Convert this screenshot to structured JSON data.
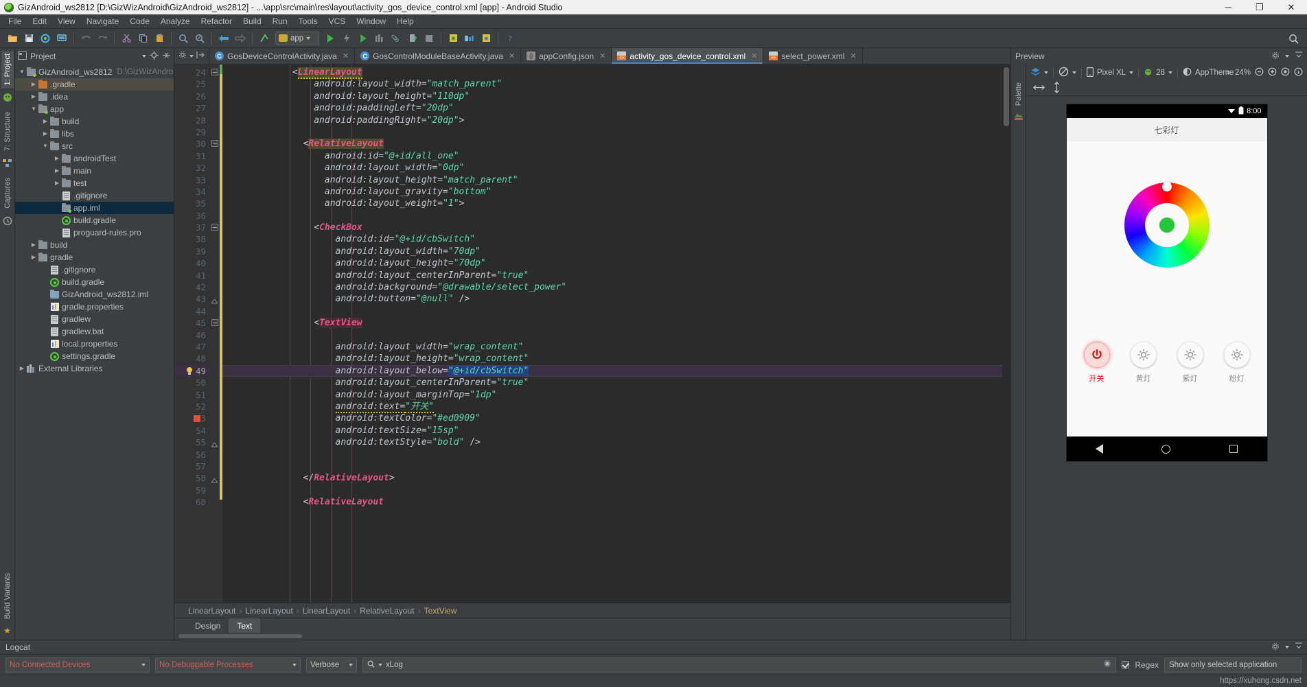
{
  "window": {
    "title": "GizAndroid_ws2812 [D:\\GizWizAndroid\\GizAndroid_ws2812] - ...\\app\\src\\main\\res\\layout\\activity_gos_device_control.xml [app] - Android Studio",
    "minimize": "─",
    "maximize": "❐",
    "close": "✕"
  },
  "menu": [
    "File",
    "Edit",
    "View",
    "Navigate",
    "Code",
    "Analyze",
    "Refactor",
    "Build",
    "Run",
    "Tools",
    "VCS",
    "Window",
    "Help"
  ],
  "toolbar": {
    "run_config": "app",
    "icons": [
      "open-folder-icon",
      "save-all-icon",
      "sync-gradle-icon",
      "avd-manager-icon",
      "undo-icon",
      "redo-icon",
      "cut-icon",
      "copy-icon",
      "paste-icon",
      "find-icon",
      "replace-icon",
      "back-icon",
      "forward-icon",
      "sdk-manager-icon",
      "run-icon",
      "debug-icon",
      "run-coverage-icon",
      "profile-icon",
      "stop-icon",
      "attach-debugger-icon",
      "layout-inspector-icon",
      "device-file-explorer-icon",
      "help-icon"
    ],
    "search_everywhere": "search-icon"
  },
  "left_rail": {
    "tabs": [
      "1: Project",
      "7: Structure",
      "Captures"
    ],
    "bottom_tabs": [
      "Build Variants",
      "Favorites"
    ],
    "active": "1: Project"
  },
  "project_panel": {
    "title": "Project",
    "tree": [
      {
        "indent": 0,
        "arrow": "▼",
        "icon": "module-folder-icon",
        "label": "GizAndroid_ws2812",
        "path": "D:\\GizWizAndroid\\",
        "state": "normal"
      },
      {
        "indent": 1,
        "arrow": "▶",
        "icon": "folder-orange-icon",
        "label": ".gradle",
        "path": "",
        "state": "highlight"
      },
      {
        "indent": 1,
        "arrow": "▶",
        "icon": "folder-icon",
        "label": ".idea",
        "path": "",
        "state": "normal"
      },
      {
        "indent": 1,
        "arrow": "▼",
        "icon": "module-folder-icon",
        "label": "app",
        "path": "",
        "state": "normal"
      },
      {
        "indent": 2,
        "arrow": "▶",
        "icon": "folder-icon",
        "label": "build",
        "path": "",
        "state": "normal"
      },
      {
        "indent": 2,
        "arrow": "▶",
        "icon": "folder-icon",
        "label": "libs",
        "path": "",
        "state": "normal"
      },
      {
        "indent": 2,
        "arrow": "▼",
        "icon": "folder-icon",
        "label": "src",
        "path": "",
        "state": "normal"
      },
      {
        "indent": 3,
        "arrow": "▶",
        "icon": "folder-icon",
        "label": "androidTest",
        "path": "",
        "state": "normal"
      },
      {
        "indent": 3,
        "arrow": "▶",
        "icon": "folder-icon",
        "label": "main",
        "path": "",
        "state": "normal"
      },
      {
        "indent": 3,
        "arrow": "▶",
        "icon": "folder-icon",
        "label": "test",
        "path": "",
        "state": "normal"
      },
      {
        "indent": 3,
        "arrow": "",
        "icon": "file-icon",
        "label": ".gitignore",
        "path": "",
        "state": "normal"
      },
      {
        "indent": 3,
        "arrow": "",
        "icon": "module-folder-icon",
        "label": "app.iml",
        "path": "",
        "state": "selected"
      },
      {
        "indent": 3,
        "arrow": "",
        "icon": "gradle-icon",
        "label": "build.gradle",
        "path": "",
        "state": "normal"
      },
      {
        "indent": 3,
        "arrow": "",
        "icon": "file-icon",
        "label": "proguard-rules.pro",
        "path": "",
        "state": "normal"
      },
      {
        "indent": 1,
        "arrow": "▶",
        "icon": "folder-icon",
        "label": "build",
        "path": "",
        "state": "normal"
      },
      {
        "indent": 1,
        "arrow": "▶",
        "icon": "folder-icon",
        "label": "gradle",
        "path": "",
        "state": "normal"
      },
      {
        "indent": 2,
        "arrow": "",
        "icon": "file-icon",
        "label": ".gitignore",
        "path": "",
        "state": "normal"
      },
      {
        "indent": 2,
        "arrow": "",
        "icon": "gradle-icon",
        "label": "build.gradle",
        "path": "",
        "state": "normal"
      },
      {
        "indent": 2,
        "arrow": "",
        "icon": "iml-icon",
        "label": "GizAndroid_ws2812.iml",
        "path": "",
        "state": "normal"
      },
      {
        "indent": 2,
        "arrow": "",
        "icon": "properties-icon",
        "label": "gradle.properties",
        "path": "",
        "state": "normal"
      },
      {
        "indent": 2,
        "arrow": "",
        "icon": "file-icon",
        "label": "gradlew",
        "path": "",
        "state": "normal"
      },
      {
        "indent": 2,
        "arrow": "",
        "icon": "file-icon",
        "label": "gradlew.bat",
        "path": "",
        "state": "normal"
      },
      {
        "indent": 2,
        "arrow": "",
        "icon": "properties-icon",
        "label": "local.properties",
        "path": "",
        "state": "normal"
      },
      {
        "indent": 2,
        "arrow": "",
        "icon": "gradle-icon",
        "label": "settings.gradle",
        "path": "",
        "state": "normal"
      },
      {
        "indent": 0,
        "arrow": "▶",
        "icon": "library-icon",
        "label": "External Libraries",
        "path": "",
        "state": "normal"
      }
    ]
  },
  "editor": {
    "tabs": [
      {
        "label": "GosDeviceControlActivity.java",
        "icon": "java-class-icon",
        "active": false
      },
      {
        "label": "GosControlModuleBaseActivity.java",
        "icon": "java-class-icon",
        "active": false
      },
      {
        "label": "appConfig.json",
        "icon": "json-file-icon",
        "active": false
      },
      {
        "label": "activity_gos_device_control.xml",
        "icon": "xml-file-icon",
        "active": true
      },
      {
        "label": "select_power.xml",
        "icon": "xml-file-icon",
        "active": false
      }
    ],
    "first_line": 24,
    "current_line": 49,
    "breakpoint_line": 53,
    "bulb_line": 49,
    "lines": [
      {
        "n": 24,
        "segs": [
          {
            "t": "<",
            "c": "pun"
          },
          {
            "t": "LinearLayout",
            "c": "tag hl1 squig"
          }
        ],
        "pad": 6
      },
      {
        "n": 25,
        "segs": [
          {
            "t": "android:layout_width=",
            "c": "attr"
          },
          {
            "t": "\"match_parent\"",
            "c": "val"
          }
        ],
        "pad": 8
      },
      {
        "n": 26,
        "segs": [
          {
            "t": "android:layout_height=",
            "c": "attr"
          },
          {
            "t": "\"110dp\"",
            "c": "val"
          }
        ],
        "pad": 8
      },
      {
        "n": 27,
        "segs": [
          {
            "t": "android:paddingLeft=",
            "c": "attr"
          },
          {
            "t": "\"20dp\"",
            "c": "val"
          }
        ],
        "pad": 8
      },
      {
        "n": 28,
        "segs": [
          {
            "t": "android:paddingRight=",
            "c": "attr"
          },
          {
            "t": "\"20dp\"",
            "c": "val"
          },
          {
            "t": ">",
            "c": "pun"
          }
        ],
        "pad": 8
      },
      {
        "n": 29,
        "segs": [],
        "pad": 0
      },
      {
        "n": 30,
        "segs": [
          {
            "t": "<",
            "c": "pun"
          },
          {
            "t": "RelativeLayout",
            "c": "tag hl1"
          }
        ],
        "pad": 7
      },
      {
        "n": 31,
        "segs": [
          {
            "t": "android:id=",
            "c": "attr"
          },
          {
            "t": "\"@+id/all_one\"",
            "c": "val"
          }
        ],
        "pad": 9
      },
      {
        "n": 32,
        "segs": [
          {
            "t": "android:layout_width=",
            "c": "attr"
          },
          {
            "t": "\"0dp\"",
            "c": "val"
          }
        ],
        "pad": 9
      },
      {
        "n": 33,
        "segs": [
          {
            "t": "android:layout_height=",
            "c": "attr"
          },
          {
            "t": "\"match_parent\"",
            "c": "val"
          }
        ],
        "pad": 9
      },
      {
        "n": 34,
        "segs": [
          {
            "t": "android:layout_gravity=",
            "c": "attr"
          },
          {
            "t": "\"bottom\"",
            "c": "val"
          }
        ],
        "pad": 9
      },
      {
        "n": 35,
        "segs": [
          {
            "t": "android:layout_weight=",
            "c": "attr"
          },
          {
            "t": "\"1\"",
            "c": "val"
          },
          {
            "t": ">",
            "c": "pun"
          }
        ],
        "pad": 9
      },
      {
        "n": 36,
        "segs": [],
        "pad": 0
      },
      {
        "n": 37,
        "segs": [
          {
            "t": "<",
            "c": "pun"
          },
          {
            "t": "CheckBox",
            "c": "tag"
          }
        ],
        "pad": 8
      },
      {
        "n": 38,
        "segs": [
          {
            "t": "android:id=",
            "c": "attr"
          },
          {
            "t": "\"@+id/cbSwitch\"",
            "c": "val"
          }
        ],
        "pad": 10
      },
      {
        "n": 39,
        "segs": [
          {
            "t": "android:layout_width=",
            "c": "attr"
          },
          {
            "t": "\"70dp\"",
            "c": "val"
          }
        ],
        "pad": 10
      },
      {
        "n": 40,
        "segs": [
          {
            "t": "android:layout_height=",
            "c": "attr"
          },
          {
            "t": "\"70dp\"",
            "c": "val"
          }
        ],
        "pad": 10
      },
      {
        "n": 41,
        "segs": [
          {
            "t": "android:layout_centerInParent=",
            "c": "attr"
          },
          {
            "t": "\"true\"",
            "c": "val"
          }
        ],
        "pad": 10
      },
      {
        "n": 42,
        "segs": [
          {
            "t": "android:background=",
            "c": "attr"
          },
          {
            "t": "\"@drawable/select_power\"",
            "c": "val"
          }
        ],
        "pad": 10
      },
      {
        "n": 43,
        "segs": [
          {
            "t": "android:button=",
            "c": "attr"
          },
          {
            "t": "\"@null\"",
            "c": "val"
          },
          {
            "t": " />",
            "c": "pun"
          }
        ],
        "pad": 10
      },
      {
        "n": 44,
        "segs": [],
        "pad": 0
      },
      {
        "n": 45,
        "segs": [
          {
            "t": "<",
            "c": "pun"
          },
          {
            "t": "TextView",
            "c": "tag hl2"
          }
        ],
        "pad": 8
      },
      {
        "n": 46,
        "segs": [],
        "pad": 0
      },
      {
        "n": 47,
        "segs": [
          {
            "t": "android:layout_width=",
            "c": "attr"
          },
          {
            "t": "\"wrap_content\"",
            "c": "val"
          }
        ],
        "pad": 10
      },
      {
        "n": 48,
        "segs": [
          {
            "t": "android:layout_height=",
            "c": "attr"
          },
          {
            "t": "\"wrap_content\"",
            "c": "val"
          }
        ],
        "pad": 10
      },
      {
        "n": 49,
        "segs": [
          {
            "t": "android:layout_below=",
            "c": "attr"
          },
          {
            "t": "\"@+id/cbSwitch\"",
            "c": "val sel"
          }
        ],
        "pad": 10
      },
      {
        "n": 50,
        "segs": [
          {
            "t": "android:layout_centerInParent=",
            "c": "attr"
          },
          {
            "t": "\"true\"",
            "c": "val"
          }
        ],
        "pad": 10
      },
      {
        "n": 51,
        "segs": [
          {
            "t": "android:layout_marginTop=",
            "c": "attr"
          },
          {
            "t": "\"1dp\"",
            "c": "val"
          }
        ],
        "pad": 10
      },
      {
        "n": 52,
        "segs": [
          {
            "t": "android:text=",
            "c": "attr squig"
          },
          {
            "t": "\"开关\"",
            "c": "val squig"
          }
        ],
        "pad": 10
      },
      {
        "n": 53,
        "segs": [
          {
            "t": "android:textColor=",
            "c": "attr"
          },
          {
            "t": "\"#ed0909\"",
            "c": "val"
          }
        ],
        "pad": 10
      },
      {
        "n": 54,
        "segs": [
          {
            "t": "android:textSize=",
            "c": "attr"
          },
          {
            "t": "\"15sp\"",
            "c": "val"
          }
        ],
        "pad": 10
      },
      {
        "n": 55,
        "segs": [
          {
            "t": "android:textStyle=",
            "c": "attr"
          },
          {
            "t": "\"bold\"",
            "c": "val"
          },
          {
            "t": " />",
            "c": "pun"
          }
        ],
        "pad": 10
      },
      {
        "n": 56,
        "segs": [],
        "pad": 0
      },
      {
        "n": 57,
        "segs": [],
        "pad": 0
      },
      {
        "n": 58,
        "segs": [
          {
            "t": "</",
            "c": "pun"
          },
          {
            "t": "RelativeLayout",
            "c": "tag"
          },
          {
            "t": ">",
            "c": "pun"
          }
        ],
        "pad": 7
      },
      {
        "n": 59,
        "segs": [],
        "pad": 0
      },
      {
        "n": 60,
        "segs": [
          {
            "t": "<",
            "c": "pun"
          },
          {
            "t": "RelativeLayout",
            "c": "tag"
          }
        ],
        "pad": 7
      }
    ],
    "breadcrumb": [
      "LinearLayout",
      "LinearLayout",
      "LinearLayout",
      "RelativeLayout",
      "TextView"
    ],
    "design_tabs": [
      {
        "label": "Design",
        "active": false
      },
      {
        "label": "Text",
        "active": true
      }
    ]
  },
  "preview": {
    "title": "Preview",
    "palette_label": "Palette",
    "device": "Pixel XL",
    "api": "28",
    "theme": "AppTheme",
    "zoom": "24%",
    "toolbar_icons": [
      "layers-icon",
      "orientation-icon",
      "device-icon",
      "api-icon",
      "theme-icon",
      "overflow-icon",
      "zoom-out-icon",
      "zoom-fit-icon",
      "zoom-actual-icon",
      "settings-icon",
      "expand-icon"
    ],
    "constraint_icons": [
      "horizontal-resize-icon",
      "vertical-resize-icon"
    ],
    "phone": {
      "status_time": "8:00",
      "app_title": "七彩灯",
      "controls": [
        {
          "label": "开关",
          "state": "on",
          "icon": "power-icon"
        },
        {
          "label": "黄灯",
          "state": "off",
          "icon": "bulb-icon"
        },
        {
          "label": "紫灯",
          "state": "off",
          "icon": "bulb-icon"
        },
        {
          "label": "粉灯",
          "state": "off",
          "icon": "bulb-icon"
        }
      ],
      "nav": [
        "back-icon",
        "home-icon",
        "recents-icon"
      ],
      "selected_color": "#24c838"
    }
  },
  "logcat": {
    "title": "Logcat",
    "device": "No Connected Devices",
    "process": "No Debuggable Processes",
    "level": "Verbose",
    "filter_value": "xLog",
    "regex_label": "Regex",
    "filter_select": "Show only selected application"
  },
  "status": {
    "watermark": "https://xuhong.csdn.net"
  }
}
